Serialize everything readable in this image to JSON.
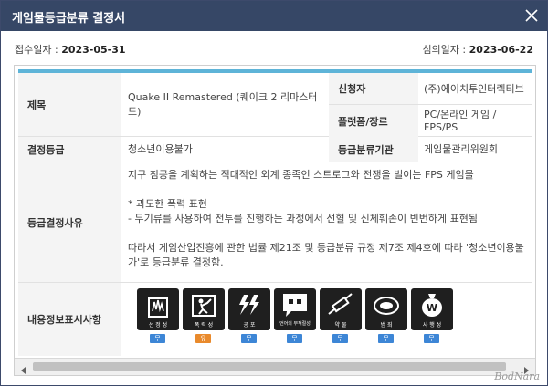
{
  "dialog": {
    "title": "게임물등급분류 결정서"
  },
  "dates": {
    "received_label": "접수일자 : ",
    "received_value": "2023-05-31",
    "review_label": "심의일자 : ",
    "review_value": "2023-06-22"
  },
  "table": {
    "title_label": "제목",
    "title_value": "Quake II Remastered (퀘이크 2 리마스터드)",
    "applicant_label": "신청자",
    "applicant_value": "(주)에이치투인터렉티브",
    "platform_label": "플랫폼/장르",
    "platform_value": "PC/온라인 게임 /  FPS/PS",
    "grade_label": "결정등급",
    "grade_value": "청소년이용불가",
    "agency_label": "등급분류기관",
    "agency_value": "게임물관리위원회",
    "reason_label": "등급결정사유",
    "reason_value": "지구 침공을 계획하는 적대적인 외계 종족인 스트로그와 전쟁을 벌이는 FPS 게임물\n\n  *  과도한 폭력 표현\n- 무기류를 사용하여 전투를 진행하는 과정에서 선혈 및 신체훼손이 빈번하게 표현됨\n\n따라서 게임산업진흥에 관한 법률 제21조 및 등급분류 규정 제7조 제4호에 따라 '청소년이용불가'로 등급분류 결정함.",
    "content_label": "내용정보표시사항"
  },
  "content_icons": [
    {
      "name": "sexuality-icon",
      "caption": "선 정 성",
      "badge": "무",
      "badge_color": "#3d86d6"
    },
    {
      "name": "violence-icon",
      "caption": "폭 력 성",
      "badge": "유",
      "badge_color": "#e98a2c"
    },
    {
      "name": "fear-icon",
      "caption": "공 포",
      "badge": "무",
      "badge_color": "#3d86d6"
    },
    {
      "name": "language-icon",
      "caption": "언어의 부적절성",
      "badge": "무",
      "badge_color": "#3d86d6"
    },
    {
      "name": "drug-icon",
      "caption": "약 물",
      "badge": "무",
      "badge_color": "#3d86d6"
    },
    {
      "name": "gambling-icon",
      "caption": "범 죄",
      "badge": "무",
      "badge_color": "#3d86d6"
    },
    {
      "name": "speculation-icon",
      "caption": "사 행 성",
      "badge": "무",
      "badge_color": "#3d86d6"
    }
  ],
  "watermark": "BodNara",
  "colors": {
    "titlebar": "#364766",
    "accent": "#5eb4d8",
    "badge_no": "#3d86d6",
    "badge_yes": "#e98a2c"
  }
}
